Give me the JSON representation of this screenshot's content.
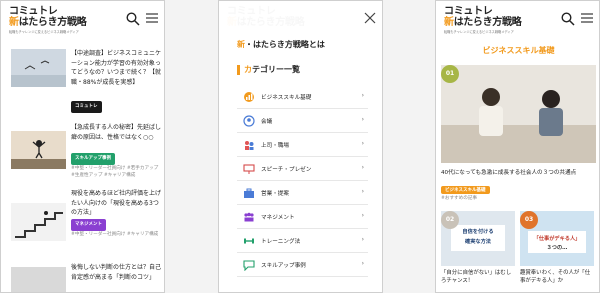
{
  "header": {
    "logo_line1": "コミュトレ",
    "logo_accent": "新",
    "logo_line2": "はたらき方戦略",
    "logo_tagline": "転職もチャレンジに変えるビジネス戦略メディア"
  },
  "panel1": {
    "articles": [
      {
        "title": "【中途調査】ビジネスコミュニケーション能力が学習の有効対象ってどうなの？いつまで続く？【就職・88%が成長を実感】",
        "tag": "コミュトレ",
        "tag_color": "black",
        "meta": ""
      },
      {
        "title": "【急成長する人の秘密】先延ばし癖の原因は、性格ではなく○○",
        "tag": "スキルアップ事例",
        "tag_color": "green",
        "meta": "#中堅・リーダー社員向け #若手カアップ #生産性アップ #キャリア構成"
      },
      {
        "title": "現役を高めるほど社内評価を上げたい人向けの「現役を高める3つの方法」",
        "tag": "マネジメント",
        "tag_color": "purple",
        "meta": "#中堅・リーダー社員向け #キャリア構成"
      },
      {
        "title": "後悔しない判断の仕方とは？自己肯定感が高まる「判断のコツ」",
        "tag": "",
        "tag_color": "green",
        "meta": ""
      }
    ]
  },
  "panel2": {
    "title_accent": "新",
    "title": "・はたらき方戦略とは",
    "category_heading_accent": "カ",
    "category_heading": "テゴリー一覧",
    "categories": [
      {
        "label": "ビジネススキル基礎",
        "icon": "chart-icon",
        "color": "#f29a1d"
      },
      {
        "label": "会議",
        "icon": "speech-icon",
        "color": "#4a7bd6"
      },
      {
        "label": "上司・職場",
        "icon": "people-icon",
        "color": "#e05555"
      },
      {
        "label": "スピーチ・プレゼン",
        "icon": "presentation-icon",
        "color": "#d64a4a"
      },
      {
        "label": "営業・提案",
        "icon": "briefcase-icon",
        "color": "#4a7bd6"
      },
      {
        "label": "マネジメント",
        "icon": "team-icon",
        "color": "#8a3fd1"
      },
      {
        "label": "トレーニング法",
        "icon": "dumbbell-icon",
        "color": "#22a06b"
      },
      {
        "label": "スキルアップ事例",
        "icon": "chat-icon",
        "color": "#22a06b"
      }
    ]
  },
  "panel3": {
    "title": "ビジネススキル基礎",
    "hero_number": "01",
    "hero_caption": "40代になっても急激に成長する社会人の３つの共通点",
    "hero_tag": "ビジネススキル基礎",
    "hero_sub": "#おすすめの記事",
    "card2_number": "02",
    "card2_overlay_line1": "自信を付ける",
    "card2_overlay_line2": "確実な方法",
    "card2_caption": "「自分に自信がない」はむしろチャンス！",
    "card3_number": "03",
    "card3_overlay_line1": "「仕事がデキる人」",
    "card3_overlay_line2": "３つの…",
    "card3_caption": "趣賞奉いわく、その人が「仕事がデキる人」か"
  }
}
